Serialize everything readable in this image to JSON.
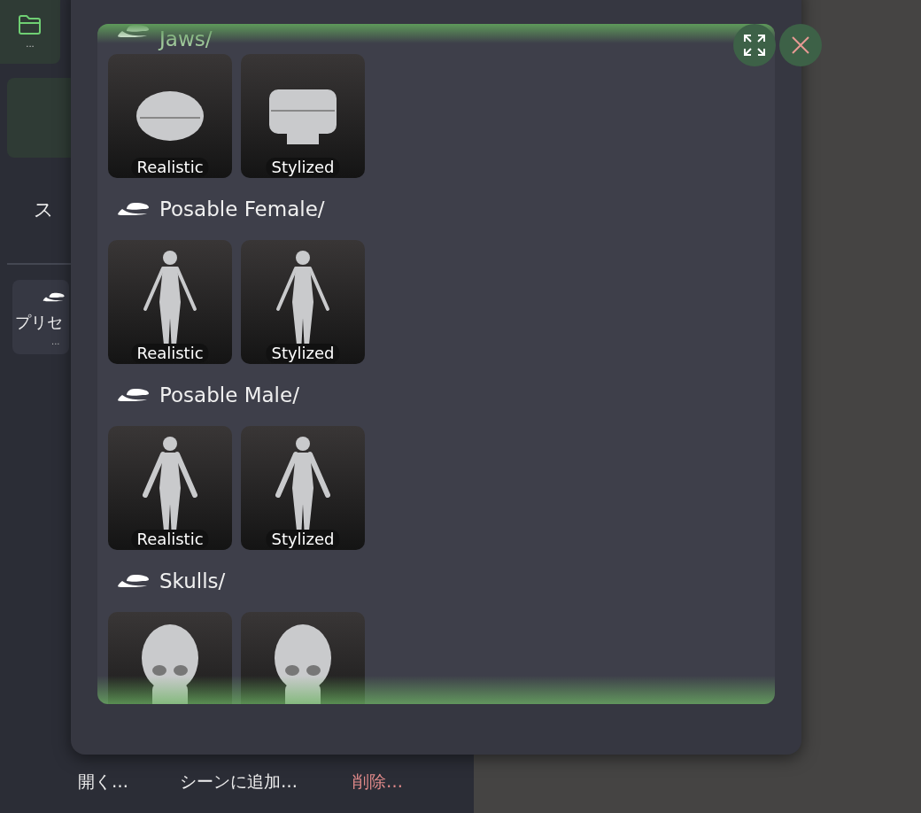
{
  "left_panel": {
    "folder_button": {
      "caption": "..."
    },
    "tab_label": "ス",
    "preset_button": {
      "label": "プリセ",
      "caption": "..."
    },
    "actions": [
      {
        "label": "開く…",
        "kind": "normal"
      },
      {
        "label": "シーンに追加…",
        "kind": "normal"
      },
      {
        "label": "削除…",
        "kind": "danger"
      }
    ]
  },
  "dialog": {
    "sections": [
      {
        "title": "Jaws/",
        "items": [
          {
            "label": "Realistic",
            "kind": "jaw"
          },
          {
            "label": "Stylized",
            "kind": "jaw-block"
          }
        ]
      },
      {
        "title": "Posable Female/",
        "items": [
          {
            "label": "Realistic",
            "kind": "female"
          },
          {
            "label": "Stylized",
            "kind": "female"
          }
        ]
      },
      {
        "title": "Posable Male/",
        "items": [
          {
            "label": "Realistic",
            "kind": "male"
          },
          {
            "label": "Stylized",
            "kind": "male"
          }
        ]
      },
      {
        "title": "Skulls/",
        "items": [
          {
            "kind": "skull"
          },
          {
            "kind": "skull"
          }
        ]
      }
    ]
  }
}
